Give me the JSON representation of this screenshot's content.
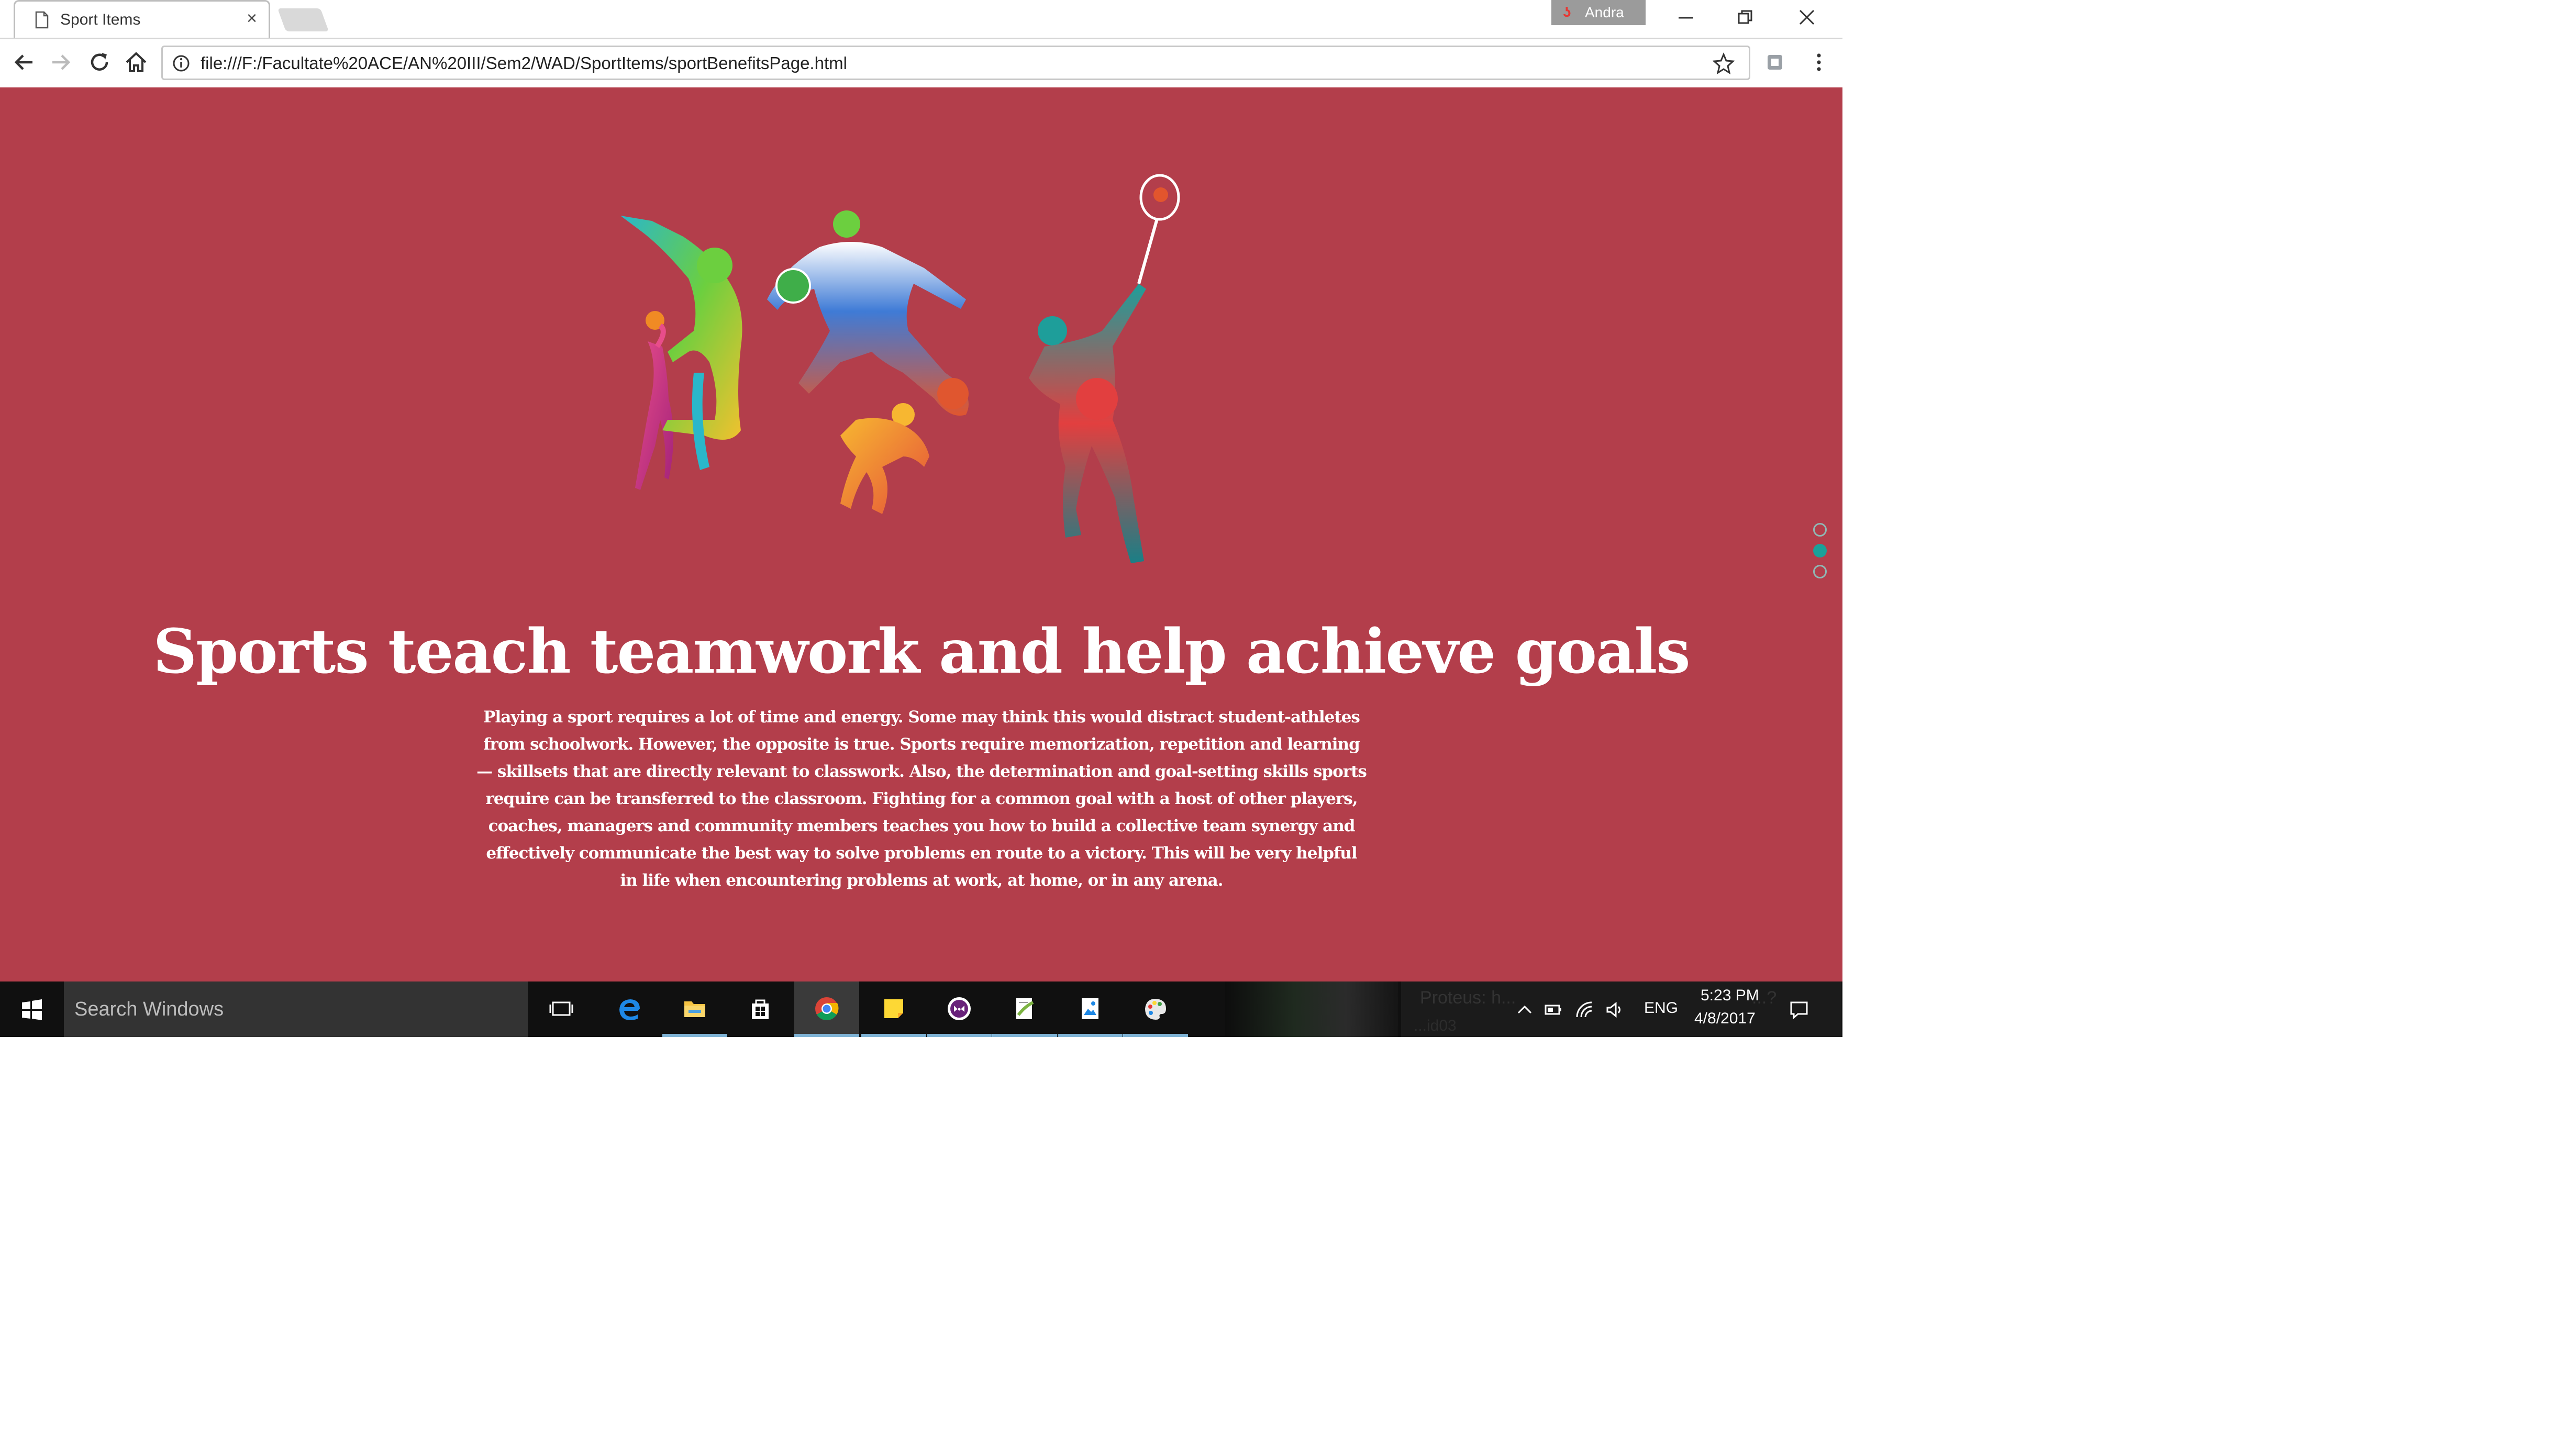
{
  "browser": {
    "tab_title": "Sport Items",
    "profile_name": "Andra",
    "url": "file:///F:/Facultate%20ACE/AN%20III/Sem2/WAD/SportItems/sportBenefitsPage.html"
  },
  "page": {
    "background": "#b33e4b",
    "headline": "Sports teach teamwork and help achieve goals",
    "body": "Playing a sport requires a lot of time and energy. Some may think this would distract student-athletes from schoolwork. However, the opposite is true. Sports require memorization, repetition and learning — skillsets that are directly relevant to classwork. Also, the determination and goal-setting skills sports require can be transferred to the classroom. Fighting for a common goal with a host of other players, coaches, managers and community members teaches you how to build a collective team synergy and effectively communicate the best way to solve problems en route to a victory. This will be very helpful in life when encountering problems at work, at home, or in any arena.",
    "pager": {
      "count": 3,
      "active_index": 1,
      "accent": "#1aa19a"
    }
  },
  "taskbar": {
    "search_placeholder": "Search Windows",
    "apps": [
      "task-view",
      "edge",
      "file-explorer",
      "store",
      "chrome",
      "sticky-notes",
      "visual-studio",
      "notepad-plus",
      "photos",
      "paint"
    ],
    "notification_peek": "Proteus: h...",
    "notification_peek_2": "...?",
    "notification_sub": "...id03",
    "language": "ENG",
    "time": "5:23 PM",
    "date": "4/8/2017"
  }
}
